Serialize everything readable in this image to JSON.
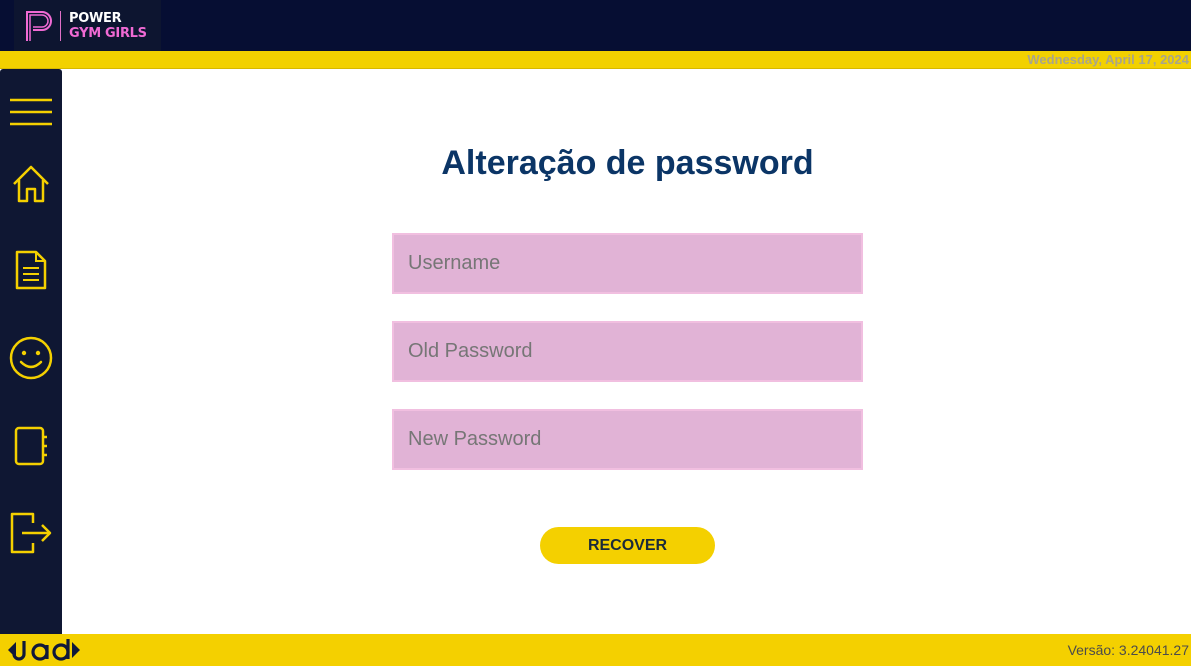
{
  "header": {
    "logo_line1": "POWER",
    "logo_line2": "GYM GIRLS",
    "date": "Wednesday, April 17, 2024"
  },
  "sidebar": {
    "items": [
      {
        "icon": "menu-icon"
      },
      {
        "icon": "home-icon"
      },
      {
        "icon": "document-icon"
      },
      {
        "icon": "smiley-icon"
      },
      {
        "icon": "notebook-icon"
      },
      {
        "icon": "logout-icon"
      }
    ],
    "icon_color": "#f4d000"
  },
  "main": {
    "title": "Alteração de password",
    "username_placeholder": "Username",
    "old_password_placeholder": "Old Password",
    "new_password_placeholder": "New Password",
    "recover_label": "RECOVER"
  },
  "footer": {
    "brand": "jad",
    "version": "Versão: 3.24041.27"
  },
  "colors": {
    "accent": "#f4d000",
    "navy": "#060e33",
    "title": "#0b3566",
    "field_bg": "#e1b3d6",
    "logo_pink": "#f06ad4"
  }
}
